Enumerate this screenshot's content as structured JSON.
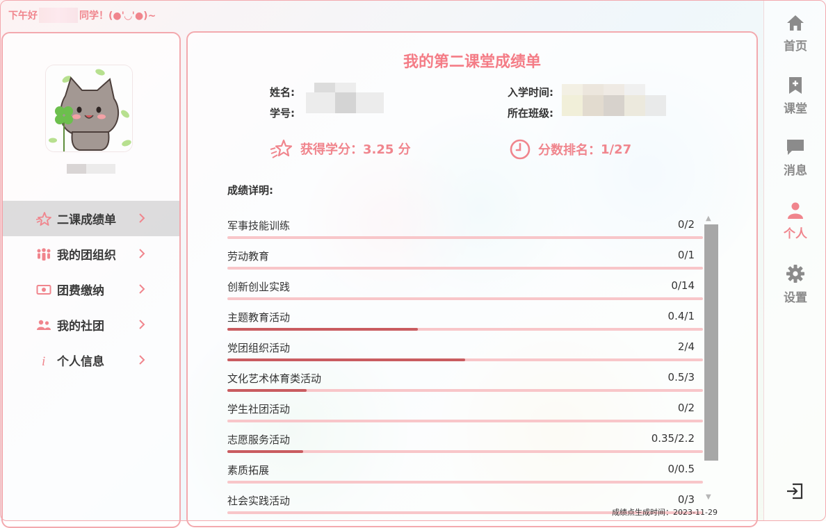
{
  "greeting": {
    "prefix": "下午好",
    "suffix": "同学！(●'◡'●)~"
  },
  "sidebar": {
    "items": [
      {
        "label": "二课成绩单",
        "icon": "star-outline-icon",
        "active": true
      },
      {
        "label": "我的团组织",
        "icon": "people-group-icon",
        "active": false
      },
      {
        "label": "团费缴纳",
        "icon": "banknote-icon",
        "active": false
      },
      {
        "label": "我的社团",
        "icon": "two-people-icon",
        "active": false
      },
      {
        "label": "个人信息",
        "icon": "info-icon",
        "active": false
      }
    ]
  },
  "main": {
    "title": "我的第二课堂成绩单",
    "info": {
      "name_label": "姓名:",
      "id_label": "学号:",
      "enroll_label": "入学时间:",
      "class_label": "所在班级:"
    },
    "credits": {
      "label": "获得学分：",
      "value": "3.25 分"
    },
    "rank": {
      "label": "分数排名：",
      "value": "1/27"
    },
    "detail_title": "成绩详明:",
    "rows": [
      {
        "name": "军事技能训练",
        "score": "0/2",
        "progress": 0
      },
      {
        "name": "劳动教育",
        "score": "0/1",
        "progress": 0
      },
      {
        "name": "创新创业实践",
        "score": "0/14",
        "progress": 0
      },
      {
        "name": "主题教育活动",
        "score": "0.4/1",
        "progress": 0.4
      },
      {
        "name": "党团组织活动",
        "score": "2/4",
        "progress": 0.5
      },
      {
        "name": "文化艺术体育类活动",
        "score": "0.5/3",
        "progress": 0.1667
      },
      {
        "name": "学生社团活动",
        "score": "0/2",
        "progress": 0
      },
      {
        "name": "志愿服务活动",
        "score": "0.35/2.2",
        "progress": 0.159
      },
      {
        "name": "素质拓展",
        "score": "0/0.5",
        "progress": 0
      },
      {
        "name": "社会实践活动",
        "score": "0/3",
        "progress": 0
      }
    ],
    "generated_time": "成绩点生成时间：2023-11-29"
  },
  "rightbar": {
    "items": [
      {
        "label": "首页",
        "icon": "home-icon"
      },
      {
        "label": "课堂",
        "icon": "bookmark-plus-icon"
      },
      {
        "label": "消息",
        "icon": "chat-bubble-icon"
      },
      {
        "label": "个人",
        "icon": "person-icon",
        "active": true
      },
      {
        "label": "设置",
        "icon": "gear-icon"
      }
    ],
    "exit_icon": "exit-icon"
  },
  "colors": {
    "accent": "#f0858d",
    "progress_fill": "#c95c60",
    "progress_track": "#f8c6c9",
    "border": "#f3a9ae"
  }
}
